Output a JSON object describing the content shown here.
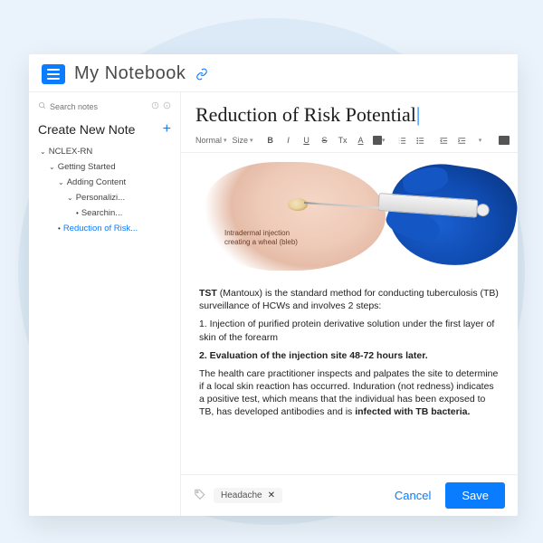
{
  "header": {
    "app_title": "My Notebook"
  },
  "sidebar": {
    "search_placeholder": "Search notes",
    "create_label": "Create New Note",
    "tree": {
      "root": "NCLEX-RN",
      "l2": "Getting Started",
      "l3": "Adding Content",
      "l4": "Personalizi...",
      "l5": "Searchin...",
      "active": "Reduction of Risk..."
    }
  },
  "toolbar": {
    "style_label": "Normal",
    "size_label": "Size",
    "bold": "B",
    "italic": "I",
    "underline": "U",
    "strike": "S",
    "tx": "Tx",
    "acolor": "A"
  },
  "document": {
    "title": "Reduction of Risk Potential",
    "annotation_l1": "Intradermal injection",
    "annotation_l2": "creating a wheal (bleb)",
    "para1_pre": "TST",
    "para1_rest": " (Mantoux) is the standard method for conducting tuberculosis (TB) surveillance of HCWs and involves 2 steps:",
    "step1": "1. Injection of purified protein derivative solution under the first layer of skin of the forearm",
    "step2": "2. Evaluation of the injection site 48-72 hours later.",
    "para2_a": "The health care practitioner inspects and palpates the site to determine if a local skin reaction has occurred.  Induration (not redness) indicates a positive test, which means that the individual has been exposed to TB, has developed antibodies and is ",
    "para2_b": "infected with TB bacteria."
  },
  "footer": {
    "tag": "Headache",
    "cancel": "Cancel",
    "save": "Save"
  }
}
